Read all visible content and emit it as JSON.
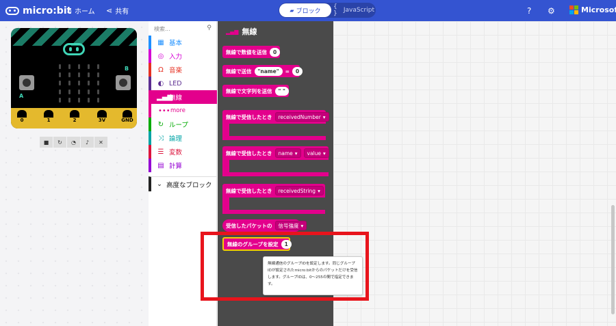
{
  "header": {
    "logo_text": "micro:bit",
    "home_label": "ホーム",
    "share_label": "共有",
    "mode_blocks": "ブロック",
    "mode_js": "JavaScript",
    "ms_label": "Microsoft"
  },
  "simulator": {
    "pins": [
      "0",
      "1",
      "2",
      "3V",
      "GND"
    ],
    "button_a": "A",
    "button_b": "B"
  },
  "toolbox": {
    "search_placeholder": "検索...",
    "categories": [
      {
        "label": "基本",
        "icon": "grid-icon",
        "color": "#1e90ff"
      },
      {
        "label": "入力",
        "icon": "target-icon",
        "color": "#d400d4"
      },
      {
        "label": "音楽",
        "icon": "headphones-icon",
        "color": "#e63022"
      },
      {
        "label": "LED",
        "icon": "toggle-icon",
        "color": "#5c2d91"
      },
      {
        "label": "無線",
        "icon": "signal-icon",
        "color": "#e3008c",
        "active": true
      },
      {
        "label": "more",
        "icon": "dots-icon",
        "color": "#e3008c",
        "sub": true
      },
      {
        "label": "ループ",
        "icon": "loop-icon",
        "color": "#00aa00"
      },
      {
        "label": "論理",
        "icon": "shuffle-icon",
        "color": "#00a4a6"
      },
      {
        "label": "変数",
        "icon": "list-icon",
        "color": "#dc143c"
      },
      {
        "label": "計算",
        "icon": "calculator-icon",
        "color": "#9400d3"
      }
    ],
    "advanced_label": "高度なブロック"
  },
  "flyout": {
    "title": "無線",
    "blocks": {
      "send_number": {
        "label": "無線で数値を送信",
        "value": "0"
      },
      "send_value": {
        "label": "無線で送信",
        "name": "\"name\"",
        "eq": "=",
        "value": "0"
      },
      "send_string": {
        "label": "無線で文字列を送信",
        "value": "\" \""
      },
      "on_received_number": {
        "label": "無線で受信したとき",
        "param": "receivedNumber"
      },
      "on_received_value": {
        "label": "無線で受信したとき",
        "param1": "name",
        "param2": "value"
      },
      "on_received_string": {
        "label": "無線で受信したとき",
        "param": "receivedString"
      },
      "packet": {
        "label": "受信したパケットの",
        "param": "信号強度"
      },
      "set_group": {
        "label": "無線のグループを設定",
        "value": "1"
      }
    },
    "tooltip": "無線通信のグループIDを設定します。同じグループIDが設定されたmicro:bitからのパケットだけを受信します。グループIDは、0〜255の間で指定できます。"
  },
  "colors": {
    "header": "#3454d1",
    "radio": "#e3008c",
    "flyout_bg": "#4a4a4a",
    "highlight": "#e8141c"
  }
}
